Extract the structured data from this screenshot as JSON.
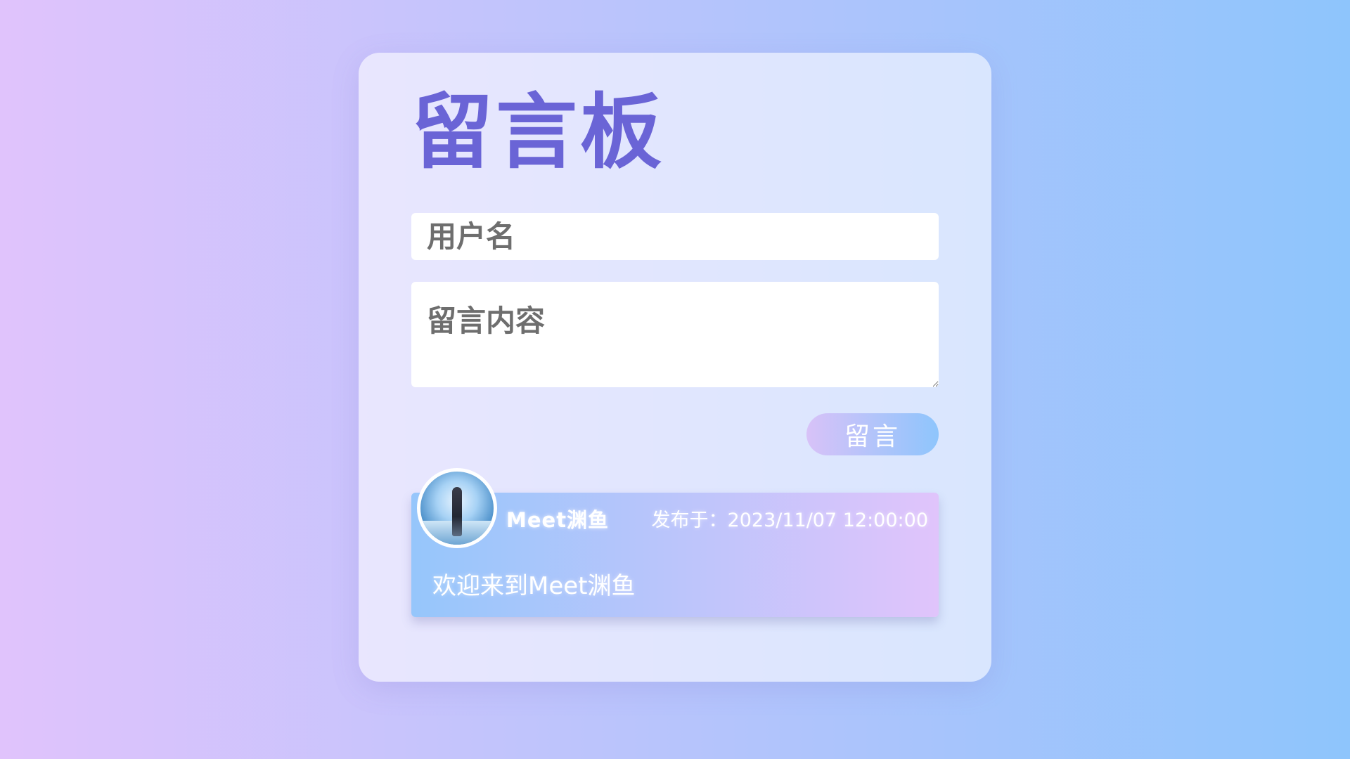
{
  "board": {
    "title": "留言板",
    "username_placeholder": "用户名",
    "content_placeholder": "留言内容",
    "submit_label": "留言"
  },
  "messages": [
    {
      "author": "Meet渊鱼",
      "time_label": "发布于：",
      "time": "2023/11/07 12:00:00",
      "text": "欢迎来到Meet渊鱼",
      "avatar_icon": "anime-girl-avatar"
    }
  ],
  "colors": {
    "background_start": "#e0c3fc",
    "background_end": "#8ec5fc",
    "title": "#6a64d6",
    "accent": "#8ec5fc"
  }
}
